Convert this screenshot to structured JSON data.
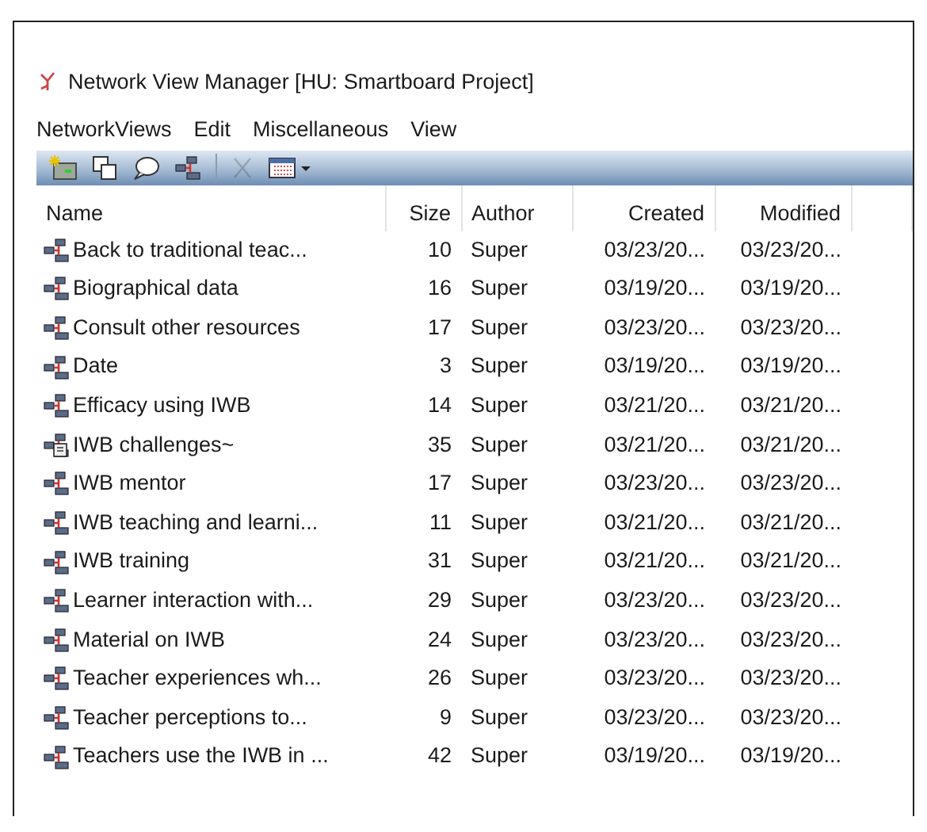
{
  "window": {
    "title": "Network View Manager [HU: Smartboard Project]"
  },
  "menu": [
    "NetworkViews",
    "Edit",
    "Miscellaneous",
    "View"
  ],
  "toolbar": [
    {
      "kind": "new",
      "disabled": false
    },
    {
      "kind": "duplicate",
      "disabled": false
    },
    {
      "kind": "comment",
      "disabled": false
    },
    {
      "kind": "network",
      "disabled": false
    },
    {
      "kind": "separator"
    },
    {
      "kind": "delete",
      "disabled": true
    },
    {
      "kind": "grid",
      "disabled": false
    }
  ],
  "table": {
    "columns": [
      "Name",
      "Size",
      "Author",
      "Created",
      "Modified"
    ],
    "rows": [
      {
        "kind": "network",
        "name": "Back to traditional teac...",
        "size": "10",
        "author": "Super",
        "created": "03/23/20...",
        "modified": "03/23/20..."
      },
      {
        "kind": "network",
        "name": "Biographical data",
        "size": "16",
        "author": "Super",
        "created": "03/19/20...",
        "modified": "03/19/20..."
      },
      {
        "kind": "network",
        "name": "Consult other resources",
        "size": "17",
        "author": "Super",
        "created": "03/23/20...",
        "modified": "03/23/20..."
      },
      {
        "kind": "network",
        "name": "Date",
        "size": "3",
        "author": "Super",
        "created": "03/19/20...",
        "modified": "03/19/20..."
      },
      {
        "kind": "network",
        "name": "Efficacy using IWB",
        "size": "14",
        "author": "Super",
        "created": "03/21/20...",
        "modified": "03/21/20..."
      },
      {
        "kind": "memo",
        "name": "IWB challenges~",
        "size": "35",
        "author": "Super",
        "created": "03/21/20...",
        "modified": "03/21/20..."
      },
      {
        "kind": "network",
        "name": "IWB mentor",
        "size": "17",
        "author": "Super",
        "created": "03/23/20...",
        "modified": "03/23/20..."
      },
      {
        "kind": "network",
        "name": "IWB teaching and learni...",
        "size": "11",
        "author": "Super",
        "created": "03/21/20...",
        "modified": "03/21/20..."
      },
      {
        "kind": "network",
        "name": "IWB training",
        "size": "31",
        "author": "Super",
        "created": "03/21/20...",
        "modified": "03/21/20..."
      },
      {
        "kind": "network",
        "name": "Learner interaction with...",
        "size": "29",
        "author": "Super",
        "created": "03/23/20...",
        "modified": "03/23/20..."
      },
      {
        "kind": "network",
        "name": "Material on IWB",
        "size": "24",
        "author": "Super",
        "created": "03/23/20...",
        "modified": "03/23/20..."
      },
      {
        "kind": "network",
        "name": "Teacher experiences wh...",
        "size": "26",
        "author": "Super",
        "created": "03/23/20...",
        "modified": "03/23/20..."
      },
      {
        "kind": "network",
        "name": "Teacher perceptions to...",
        "size": "9",
        "author": "Super",
        "created": "03/23/20...",
        "modified": "03/23/20..."
      },
      {
        "kind": "network",
        "name": "Teachers use the IWB in ...",
        "size": "42",
        "author": "Super",
        "created": "03/19/20...",
        "modified": "03/19/20..."
      }
    ]
  }
}
